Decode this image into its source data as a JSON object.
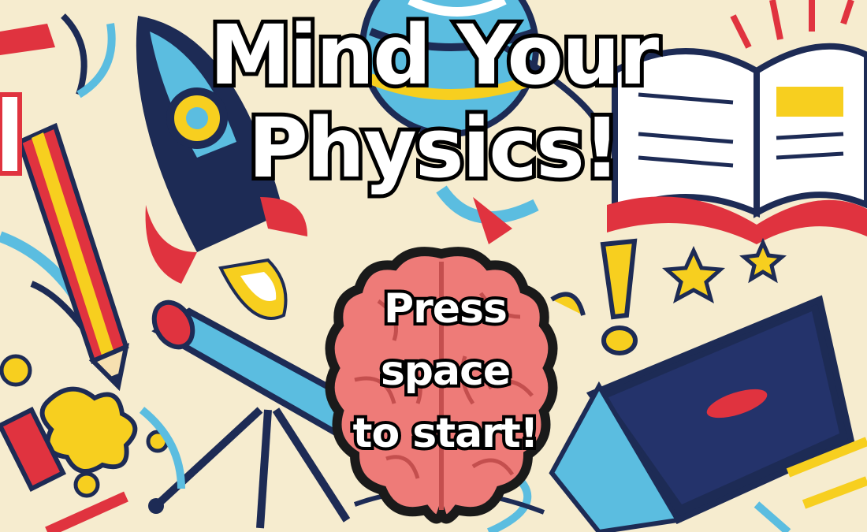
{
  "title": {
    "line1": "Mind Your",
    "line2": "Physics!"
  },
  "start_prompt": {
    "line1": "Press",
    "line2": "space",
    "line3": "to start!"
  },
  "colors": {
    "background": "#f6eccf",
    "navy": "#1d2b55",
    "red": "#e0333f",
    "yellow": "#f7cf1f",
    "sky": "#5bbde0",
    "brain": "#ee7b78"
  },
  "icons": [
    "rocket-icon",
    "open-book-icon",
    "globe-icon",
    "telescope-icon",
    "laptop-icon",
    "pencil-icon",
    "star-icon",
    "exclamation-icon",
    "brain-icon"
  ]
}
